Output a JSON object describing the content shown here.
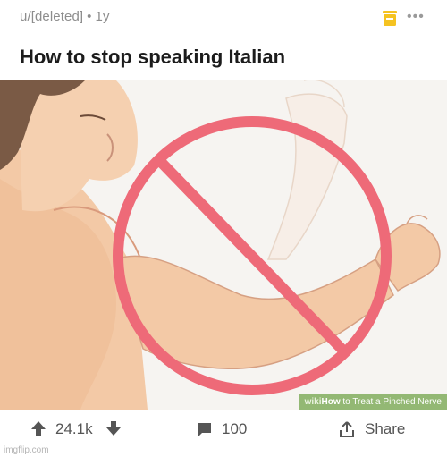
{
  "post": {
    "author": "u/[deleted]",
    "age": "1y",
    "title": "How to stop speaking Italian"
  },
  "image": {
    "watermark_wiki": "wiki",
    "watermark_how": "How",
    "watermark_text": "to Treat a Pinched Nerve"
  },
  "actions": {
    "upvotes": "24.1k",
    "comments": "100",
    "share_label": "Share"
  },
  "footer": {
    "watermark": "imgflip.com"
  },
  "colors": {
    "no_sign": "#ee6a78",
    "skin": "#f3c9a6",
    "save_icon": "#f5c321",
    "watermark_bg": "#93b874"
  },
  "icons": [
    "save-icon",
    "more-icon",
    "upvote-icon",
    "downvote-icon",
    "comment-icon",
    "share-icon"
  ]
}
